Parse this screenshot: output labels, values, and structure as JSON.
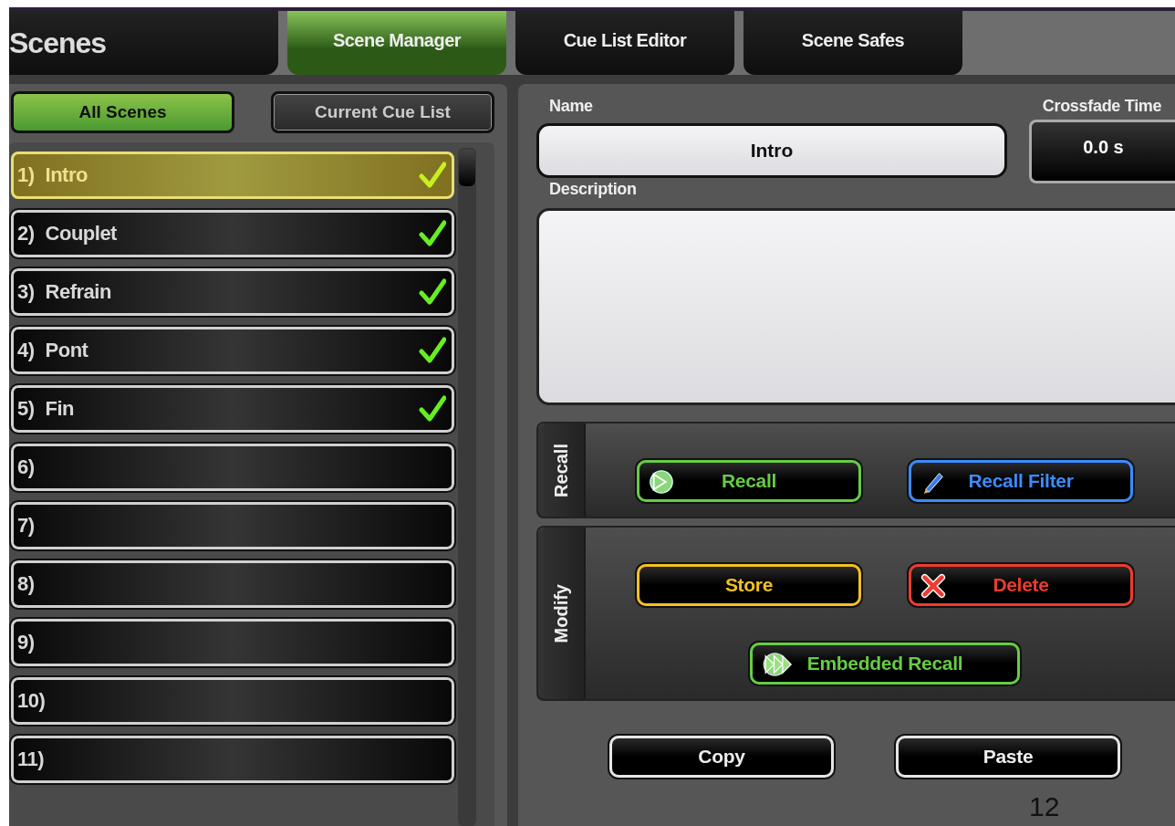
{
  "header": {
    "title": "Scenes"
  },
  "tabs": [
    {
      "label": "Scene Manager",
      "selected": true
    },
    {
      "label": "Cue List Editor",
      "selected": false
    },
    {
      "label": "Scene Safes",
      "selected": false
    }
  ],
  "filters": [
    {
      "label": "All Scenes",
      "selected": true
    },
    {
      "label": "Current Cue List",
      "selected": false
    }
  ],
  "scenes": [
    {
      "number": "1)",
      "name": "Intro",
      "checked": true,
      "selected": true
    },
    {
      "number": "2)",
      "name": "Couplet",
      "checked": true,
      "selected": false
    },
    {
      "number": "3)",
      "name": "Refrain",
      "checked": true,
      "selected": false
    },
    {
      "number": "4)",
      "name": "Pont",
      "checked": true,
      "selected": false
    },
    {
      "number": "5)",
      "name": "Fin",
      "checked": true,
      "selected": false
    },
    {
      "number": "6)",
      "checked": false,
      "selected": false
    },
    {
      "number": "7)",
      "checked": false,
      "selected": false
    },
    {
      "number": "8)",
      "checked": false,
      "selected": false
    },
    {
      "number": "9)",
      "checked": false,
      "selected": false
    },
    {
      "number": "10)",
      "checked": false,
      "selected": false
    },
    {
      "number": "11)",
      "checked": false,
      "selected": false
    }
  ],
  "name_field": {
    "label": "Name",
    "value": "Intro"
  },
  "crossfade": {
    "label": "Crossfade Time",
    "value": "0.0 s"
  },
  "description": {
    "label": "Description"
  },
  "sections": [
    {
      "title": "Recall",
      "rows": [
        [
          {
            "label": "Recall",
            "color": "#66cc44",
            "kind": "play"
          },
          {
            "label": "Recall Filter",
            "color": "#3b8cff",
            "kind": "pencil"
          }
        ]
      ]
    },
    {
      "title": "Modify",
      "rows": [
        [
          {
            "label": "Store",
            "color": "#f5c020",
            "kind": "plain"
          },
          {
            "label": "Delete",
            "color": "#ee3b30",
            "kind": "cross"
          }
        ],
        [
          {
            "label": "Embedded Recall",
            "color": "#66cc44",
            "kind": "multiplay"
          }
        ]
      ]
    }
  ],
  "clipboard": [
    {
      "label": "Copy",
      "color": "#e6e6e6"
    },
    {
      "label": "Paste",
      "color": "#e6e6e6"
    }
  ],
  "page_number": "12"
}
